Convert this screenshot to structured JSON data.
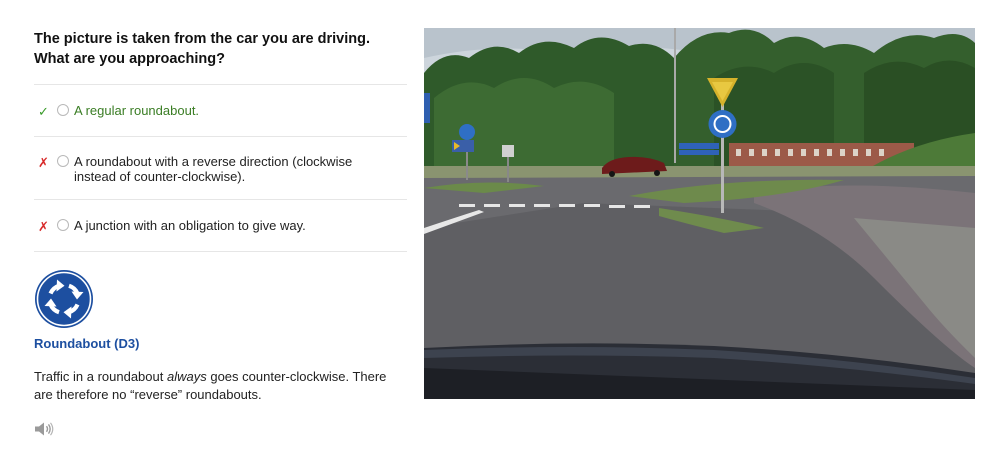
{
  "question": {
    "line1": "The picture is taken from the car you are driving.",
    "line2": "What are you approaching?"
  },
  "answers": [
    {
      "text": "A regular roundabout.",
      "status": "correct",
      "mark": "✓"
    },
    {
      "text": "A roundabout with a reverse direction (clockwise instead of counter-clockwise).",
      "status": "wrong",
      "mark": "✗"
    },
    {
      "text": "A junction with an obligation to give way.",
      "status": "wrong",
      "mark": "✗"
    }
  ],
  "sign": {
    "name": "Roundabout (D3)",
    "icon": "roundabout-sign-icon",
    "color": "#1d4fa0"
  },
  "explanation": {
    "before": "Traffic in a roundabout ",
    "emphasis": "always",
    "after": " goes counter-clockwise. There are therefore no “reverse” roundabouts."
  },
  "audio": {
    "icon": "speaker-icon"
  },
  "colors": {
    "correct_text": "#3a7d24",
    "correct_mark": "#3a9b2a",
    "wrong_mark": "#d82a2a",
    "sign_blue": "#1d4fa0",
    "divider": "#e6e6e6"
  }
}
